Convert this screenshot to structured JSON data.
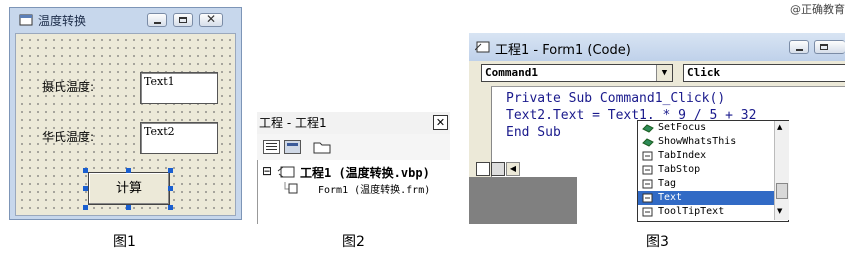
{
  "watermark": "@正确教育",
  "fig1": {
    "caption": "图1",
    "window_title": "温度转换",
    "label_celsius": "摄氏温度:",
    "text1": "Text1",
    "label_fahrenheit": "华氏温度:",
    "text2": "Text2",
    "button": "计算"
  },
  "fig2": {
    "caption": "图2",
    "title": "工程 - 工程1",
    "close": "✕",
    "tree_expander": "⊟",
    "project_node": "工程1 (温度转换.vbp)",
    "form_node": "Form1 (温度转换.frm)"
  },
  "fig3": {
    "caption": "图3",
    "window_title": "工程1 - Form1 (Code)",
    "object_combo": "Command1",
    "proc_combo": "Click",
    "code_lines": [
      "Private Sub Command1_Click()",
      "Text2.Text = Text1. * 9 / 5 + 32",
      "End Sub"
    ],
    "autocomplete_items": [
      {
        "label": "SetFocus",
        "icon": "method-icon"
      },
      {
        "label": "ShowWhatsThis",
        "icon": "method-icon"
      },
      {
        "label": "TabIndex",
        "icon": "property-icon"
      },
      {
        "label": "TabStop",
        "icon": "property-icon"
      },
      {
        "label": "Tag",
        "icon": "property-icon"
      },
      {
        "label": "Text",
        "icon": "property-icon",
        "selected": true
      },
      {
        "label": "ToolTipText",
        "icon": "property-icon"
      }
    ],
    "colors": {
      "keyword": "#1a1a8c",
      "selection": "#316ac5"
    }
  }
}
